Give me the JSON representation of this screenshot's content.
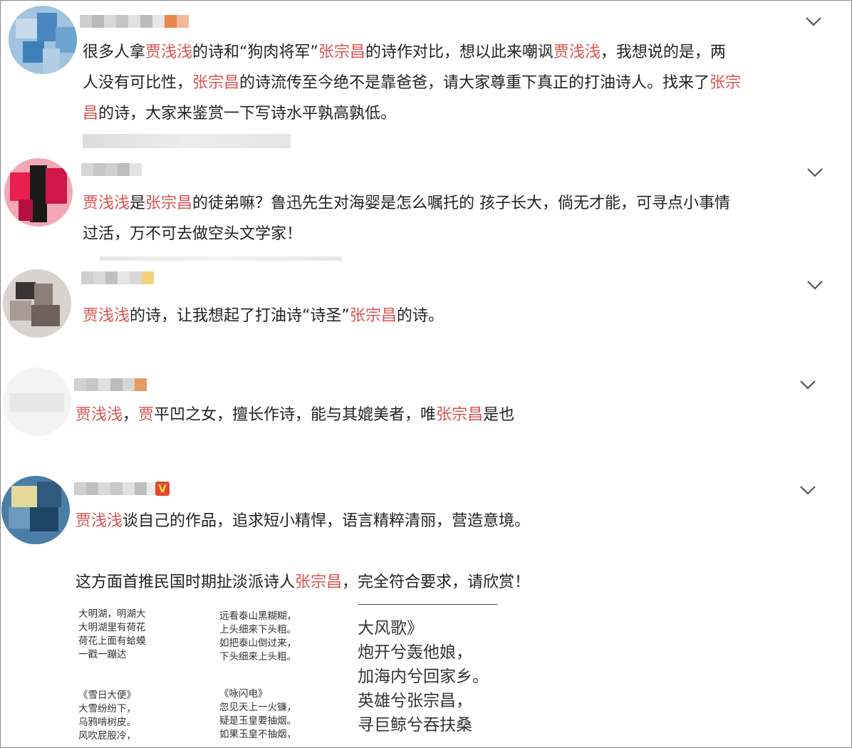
{
  "colors": {
    "highlight": "#d9534f",
    "text": "#222222"
  },
  "comments": [
    {
      "lines": [
        [
          {
            "t": "很多人拿"
          },
          {
            "t": "贾浅浅",
            "h": true
          },
          {
            "t": "的诗和“狗肉将军”"
          },
          {
            "t": "张宗昌",
            "h": true
          },
          {
            "t": "的诗作对比，想以此来嘲讽"
          },
          {
            "t": "贾浅浅",
            "h": true
          },
          {
            "t": "，我想说的是，两"
          }
        ],
        [
          {
            "t": "人没有可比性，"
          },
          {
            "t": "张宗昌",
            "h": true
          },
          {
            "t": "的诗流传至今绝不是靠爸爸，请大家尊重下真正的打油诗人。找来了"
          },
          {
            "t": "张宗",
            "h": true
          }
        ],
        [
          {
            "t": "昌",
            "h": true
          },
          {
            "t": "的诗，大家来鉴赏一下写诗水平孰高孰低。"
          }
        ]
      ]
    },
    {
      "lines": [
        [
          {
            "t": "贾浅浅",
            "h": true
          },
          {
            "t": "是"
          },
          {
            "t": "张宗昌",
            "h": true
          },
          {
            "t": "的徒弟嘛？鲁迅先生对海婴是怎么嘱托的 孩子长大，倘无才能，可寻点小事情"
          }
        ],
        [
          {
            "t": "过活，万不可去做空头文学家！"
          }
        ]
      ]
    },
    {
      "lines": [
        [
          {
            "t": "贾浅浅",
            "h": true
          },
          {
            "t": "的诗，让我想起了打油诗“诗圣”"
          },
          {
            "t": "张宗昌",
            "h": true
          },
          {
            "t": "的诗。"
          }
        ]
      ]
    },
    {
      "lines": [
        [
          {
            "t": "贾浅浅",
            "h": true
          },
          {
            "t": "，"
          },
          {
            "t": "贾",
            "h": true
          },
          {
            "t": "平凹之女，擅长作诗，能与其媲美者，唯"
          },
          {
            "t": "张宗昌",
            "h": true
          },
          {
            "t": "是也"
          }
        ]
      ]
    },
    {
      "lines": [
        [
          {
            "t": "贾浅浅",
            "h": true
          },
          {
            "t": "谈自己的作品，追求短小精悍，语言精粹清丽，营造意境。"
          }
        ],
        [
          {
            "t": ""
          }
        ],
        [
          {
            "t": "这方面首推民国时期扯淡派诗人"
          },
          {
            "t": "张宗昌",
            "h": true
          },
          {
            "t": "，完全符合要求，请欣赏！"
          }
        ]
      ]
    }
  ],
  "poems": {
    "col1_top": [
      "大明湖，明湖大",
      "大明湖里有荷花",
      "荷花上面有蛤蟆",
      "一戳一蹦达"
    ],
    "col1_bottom": [
      "《雪日大便》",
      "大雪纷纷下，",
      "乌鸦啃树皮。",
      "风吹屁股冷，"
    ],
    "col2_top": [
      "远看泰山黑糊糊，",
      "上头细来下头粗。",
      "如把泰山倒过来，",
      "下头细来上头粗。"
    ],
    "col2_bottom": [
      "《咏闪电》",
      "忽见天上一火镰，",
      "疑是玉皇要抽烟。",
      "如果玉皇不抽烟，"
    ],
    "big": [
      "大风歌》",
      "炮开兮轰他娘，",
      "加海内兮回家乡。",
      "英雄兮张宗昌，",
      "寻巨鲸兮吞扶桑"
    ]
  },
  "icons": {
    "expand": "chevron-down-icon"
  }
}
